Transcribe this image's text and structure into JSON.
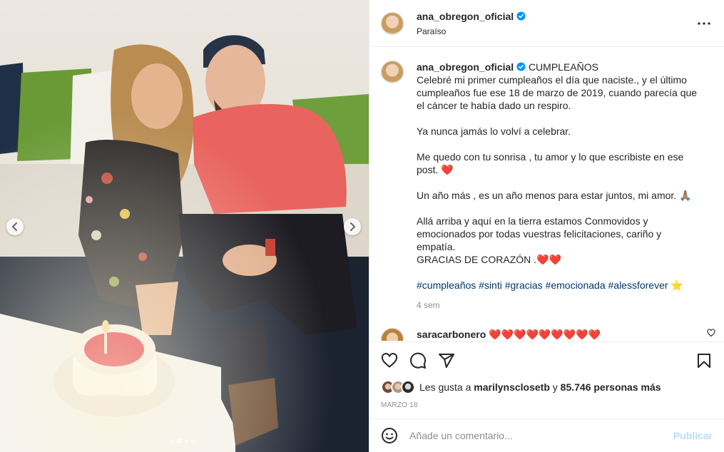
{
  "post": {
    "username": "ana_obregon_oficial",
    "location": "Paraíso",
    "carousel": {
      "total": 4,
      "active_index": 1
    }
  },
  "caption": {
    "username": "ana_obregon_oficial",
    "title": "CUMPLEAÑOS",
    "p1": "Celebré mi primer cumpleaños el día que naciste., y el último cumpleaños fue ese 18 de marzo de 2019, cuando parecía que el cáncer te había dado un respiro.",
    "p2": "Ya nunca jamás lo volví a celebrar.",
    "p3": "Me quedo con tu sonrisa , tu amor y lo que escribiste en ese post. ❤️",
    "p4": "Un año más , es un año menos para estar juntos, mi amor. 🙏🏽",
    "p5a": "Allá arriba y aquí en la tierra estamos Conmovidos y emocionados por todas vuestras felicitaciones, cariño y empatía.",
    "p5b": "GRACIAS DE CORAZÓN .❤️❤️",
    "hashtags": "#cumpleaños #sinti #gracias #emocionada #alessforever ⭐",
    "time_ago": "4 sem"
  },
  "comments": [
    {
      "username": "saracarbonero",
      "text": "❤️❤️❤️❤️❤️❤️❤️❤️❤️"
    }
  ],
  "likes": {
    "prefix": "Les gusta a",
    "user": "marilynsclosetb",
    "connector": "y",
    "count_text": "85.746 personas más"
  },
  "date": "MARZO 18",
  "add_comment": {
    "placeholder": "Añade un comentario...",
    "publish_label": "Publicar"
  },
  "colors": {
    "verified": "#0095f6",
    "hashtag": "#00376b",
    "publish_disabled": "#b2dffc"
  },
  "icons": [
    "verified-icon",
    "more-options-icon",
    "heart-icon",
    "comment-icon",
    "share-icon",
    "bookmark-icon",
    "emoji-icon",
    "chevron-left-icon",
    "chevron-right-icon"
  ]
}
